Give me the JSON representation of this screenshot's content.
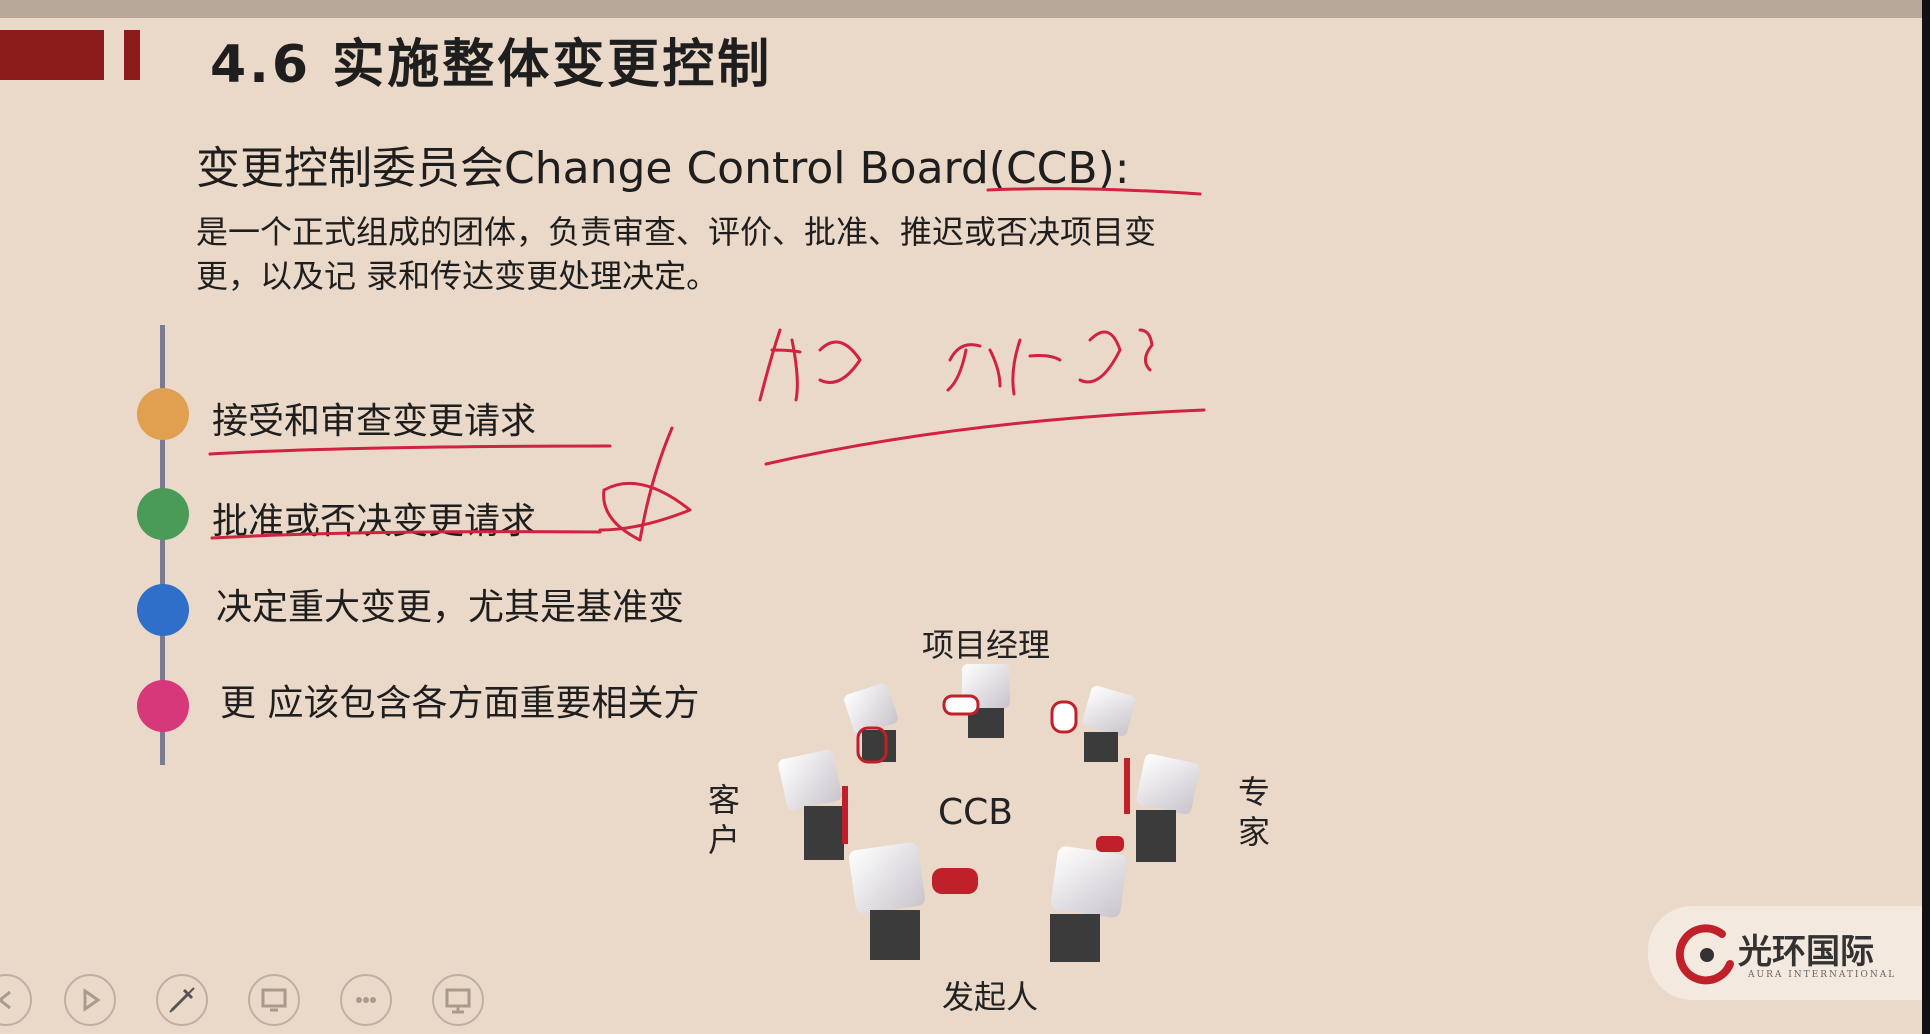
{
  "slide": {
    "title": "4.6 实施整体变更控制",
    "subtitle": "变更控制委员会Change Control Board(CCB):",
    "description": "是一个正式组成的团体，负责审查、评价、批准、推迟或否决项目变更，以及记 录和传达变更处理决定。",
    "items": [
      {
        "label": "接受和审查变更请求",
        "color": "#e0a050"
      },
      {
        "label": "批准或否决变更请求",
        "color": "#4a9a58"
      },
      {
        "label": "决定重大变更，尤其是基准变",
        "color": "#2f6fc9"
      },
      {
        "label": "更 应该包含各方面重要相关方",
        "color": "#d6387a"
      }
    ],
    "diagram": {
      "center": "CCB",
      "top": "项目经理",
      "left": "客户",
      "right": "专家",
      "bottom": "发起人"
    },
    "annotation_color": "#d1233f"
  },
  "logo": {
    "text": "光环国际",
    "subtext": "AURA INTERNATIONAL",
    "accent": "#c0202a"
  },
  "controls": [
    {
      "name": "previous-icon"
    },
    {
      "name": "play-icon"
    },
    {
      "name": "pen-icon"
    },
    {
      "name": "pointer-icon"
    },
    {
      "name": "more-icon"
    },
    {
      "name": "screen-icon"
    }
  ]
}
